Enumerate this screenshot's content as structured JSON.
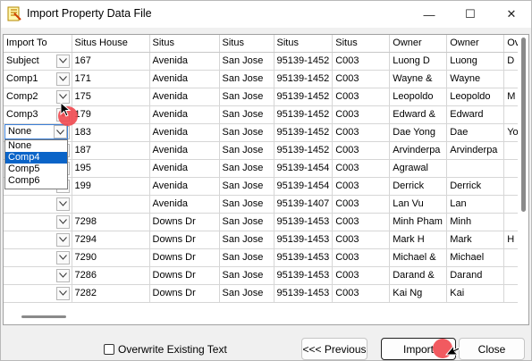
{
  "window": {
    "title": "Import Property Data File",
    "min_glyph": "—",
    "max_glyph": "☐",
    "close_glyph": "✕"
  },
  "grid": {
    "columns": [
      "Import To",
      "Situs House",
      "Situs",
      "Situs",
      "Situs",
      "Situs",
      "Owner",
      "Owner",
      "Ov"
    ],
    "rows": [
      {
        "import": "Subject",
        "c": [
          "167",
          "Avenida",
          "San Jose",
          "95139-1452",
          "C003",
          "Luong D",
          "Luong",
          "D"
        ]
      },
      {
        "import": "Comp1",
        "c": [
          "171",
          "Avenida",
          "San Jose",
          "95139-1452",
          "C003",
          "Wayne &",
          "Wayne",
          ""
        ]
      },
      {
        "import": "Comp2",
        "c": [
          "175",
          "Avenida",
          "San Jose",
          "95139-1452",
          "C003",
          "Leopoldo",
          "Leopoldo",
          "M"
        ]
      },
      {
        "import": "Comp3",
        "c": [
          "179",
          "Avenida",
          "San Jose",
          "95139-1452",
          "C003",
          "Edward &",
          "Edward",
          ""
        ]
      },
      {
        "import": "None",
        "c": [
          "183",
          "Avenida",
          "San Jose",
          "95139-1452",
          "C003",
          "Dae Yong",
          "Dae",
          "Yo"
        ]
      },
      {
        "import": "",
        "c": [
          "187",
          "Avenida",
          "San Jose",
          "95139-1452",
          "C003",
          "Arvinderpa",
          "Arvinderpa",
          ""
        ]
      },
      {
        "import": "",
        "c": [
          "195",
          "Avenida",
          "San Jose",
          "95139-1454",
          "C003",
          "Agrawal",
          "",
          ""
        ]
      },
      {
        "import": "",
        "c": [
          "199",
          "Avenida",
          "San Jose",
          "95139-1454",
          "C003",
          "Derrick",
          "Derrick",
          ""
        ]
      },
      {
        "import": "",
        "c": [
          "",
          "Avenida",
          "San Jose",
          "95139-1407",
          "C003",
          "Lan Vu",
          "Lan",
          ""
        ]
      },
      {
        "import": "",
        "c": [
          "7298",
          "Downs Dr",
          "San Jose",
          "95139-1453",
          "C003",
          "Minh Pham",
          "Minh",
          ""
        ]
      },
      {
        "import": "",
        "c": [
          "7294",
          "Downs Dr",
          "San Jose",
          "95139-1453",
          "C003",
          "Mark H",
          "Mark",
          "H"
        ]
      },
      {
        "import": "",
        "c": [
          "7290",
          "Downs Dr",
          "San Jose",
          "95139-1453",
          "C003",
          "Michael &",
          "Michael",
          ""
        ]
      },
      {
        "import": "",
        "c": [
          "7286",
          "Downs Dr",
          "San Jose",
          "95139-1453",
          "C003",
          "Darand &",
          "Darand",
          ""
        ]
      },
      {
        "import": "",
        "c": [
          "7282",
          "Downs Dr",
          "San Jose",
          "95139-1453",
          "C003",
          "Kai Ng",
          "Kai",
          ""
        ]
      }
    ]
  },
  "dropdown": {
    "current": "None",
    "options": [
      "None",
      "Comp4",
      "Comp5",
      "Comp6"
    ],
    "highlighted": "Comp4"
  },
  "footer": {
    "overwrite_label": "Overwrite Existing Text",
    "overwrite_checked": false,
    "previous_label": "<<< Previous",
    "import_label": "Import",
    "close_label": "Close"
  },
  "colors": {
    "selection": "#0a64c8",
    "cursor_marker": "#f0484f"
  }
}
